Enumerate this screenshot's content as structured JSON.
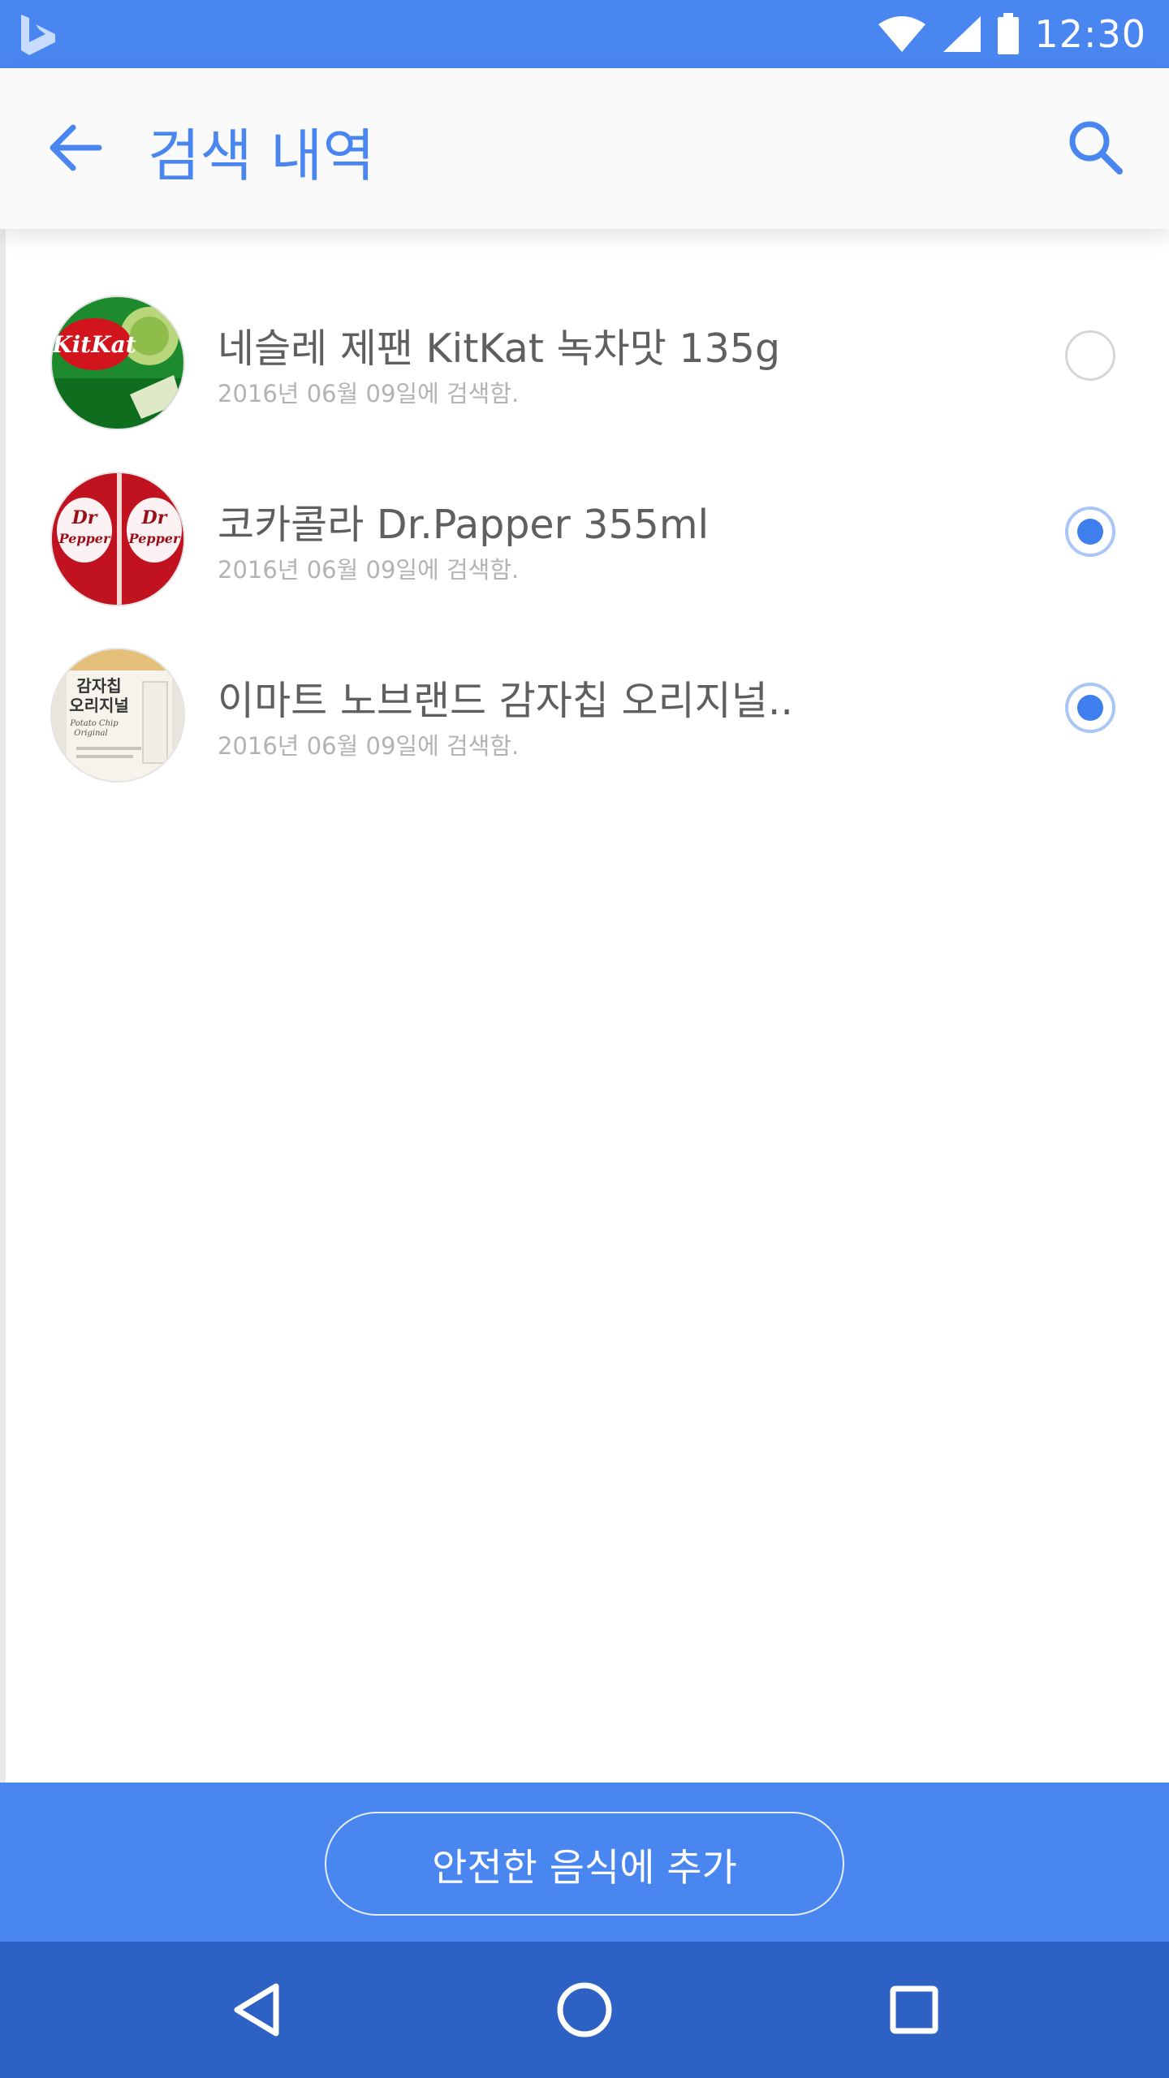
{
  "status_bar": {
    "time": "12:30",
    "icons": [
      "bing-logo-icon",
      "wifi-icon",
      "signal-icon",
      "battery-icon"
    ]
  },
  "app_bar": {
    "title": "검색 내역",
    "back_icon": "arrow-left-icon",
    "search_icon": "search-icon"
  },
  "history": {
    "items": [
      {
        "title": "네슬레 제팬 KitKat 녹차맛 135g",
        "date": "2016년 06월 09일에 검색함.",
        "selected": false,
        "thumbnail": "kitkat-green-tea-thumbnail"
      },
      {
        "title": "코카콜라 Dr.Papper 355ml",
        "date": "2016년 06월 09일에 검색함.",
        "selected": true,
        "thumbnail": "dr-pepper-can-thumbnail"
      },
      {
        "title": "이마트 노브랜드 감자칩 오리지널..",
        "date": "2016년 06월 09일에 검색함.",
        "selected": true,
        "thumbnail": "potato-chip-bag-thumbnail"
      }
    ]
  },
  "thumbnail_text": {
    "kitkat": "KitKat",
    "drpepper_line1": "Dr",
    "drpepper_line2": "Pepper",
    "chips_line1": "감자칩",
    "chips_line2": "오리지널",
    "chips_line3": "Potato Chip",
    "chips_line4": "Original"
  },
  "action": {
    "add_button_label": "안전한 음식에 추가"
  },
  "nav_bar": {
    "icons": [
      "back-triangle-icon",
      "home-circle-icon",
      "recents-square-icon"
    ]
  },
  "colors": {
    "primary": "#4a86f0",
    "nav": "#2d62c4",
    "radio_checked": "#3f80ee",
    "title_text": "#5f5f5f",
    "date_text": "#b3b3b3"
  }
}
